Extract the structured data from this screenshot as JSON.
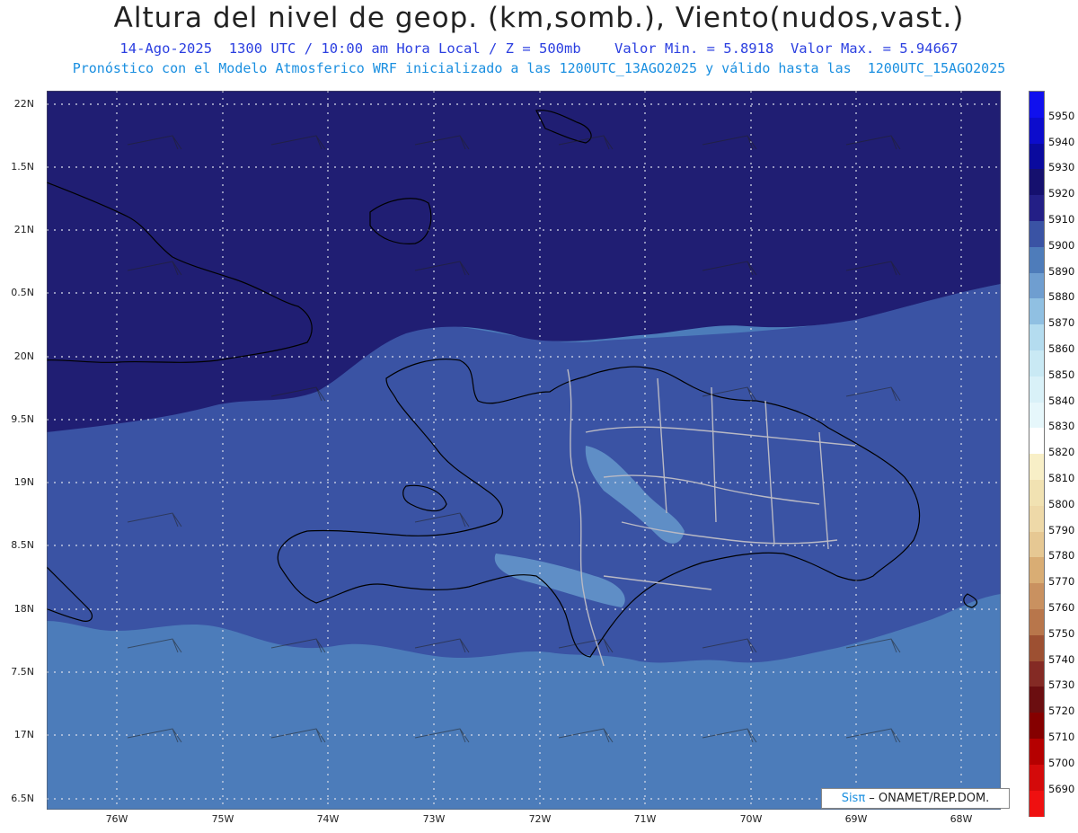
{
  "header": {
    "title": "Altura del nivel de geop. (km,somb.), Viento(nudos,vast.)",
    "subtitle1": "14-Ago-2025  1300 UTC / 10:00 am Hora Local / Z = 500mb    Valor Min. = 5.8918  Valor Max. = 5.94667",
    "subtitle2": "Pronóstico con el Modelo Atmosferico WRF inicializado a las 1200UTC_13AGO2025 y válido hasta las  1200UTC_15AGO2025"
  },
  "axes": {
    "lat_labels": [
      "22N",
      "1.5N",
      "21N",
      "0.5N",
      "20N",
      "9.5N",
      "19N",
      "8.5N",
      "18N",
      "7.5N",
      "17N",
      "6.5N"
    ],
    "lon_labels": [
      "76W",
      "75W",
      "74W",
      "73W",
      "72W",
      "71W",
      "70W",
      "69W",
      "68W"
    ]
  },
  "colorbar": {
    "labels": [
      "5950",
      "5940",
      "5930",
      "5920",
      "5910",
      "5900",
      "5890",
      "5880",
      "5870",
      "5860",
      "5850",
      "5840",
      "5830",
      "5820",
      "5810",
      "5800",
      "5790",
      "5780",
      "5770",
      "5760",
      "5750",
      "5740",
      "5730",
      "5720",
      "5710",
      "5700",
      "5690"
    ],
    "colors": [
      "#1010ee",
      "#0c0ccc",
      "#0a0a9e",
      "#15106e",
      "#231f86",
      "#3a53a4",
      "#4e7cba",
      "#6f9ed0",
      "#90c0e2",
      "#b4dcef",
      "#c9e9f4",
      "#d9f1f8",
      "#e6f7fb",
      "#ffffff",
      "#f8efc7",
      "#f1e2b2",
      "#eed9a8",
      "#e6c893",
      "#d9ad74",
      "#c99160",
      "#b8764b",
      "#9d5032",
      "#842a24",
      "#6b0e10",
      "#850000",
      "#b50000",
      "#d40a0a",
      "#ef1010"
    ]
  },
  "map": {
    "levels": {
      "outer": "#201e73",
      "mid": "#3a53a4",
      "low": "#4c7cba",
      "light": "#5f8ec6"
    }
  },
  "credit": {
    "brand": "Sisπ",
    "text": " – ONAMET/REP.DOM."
  }
}
